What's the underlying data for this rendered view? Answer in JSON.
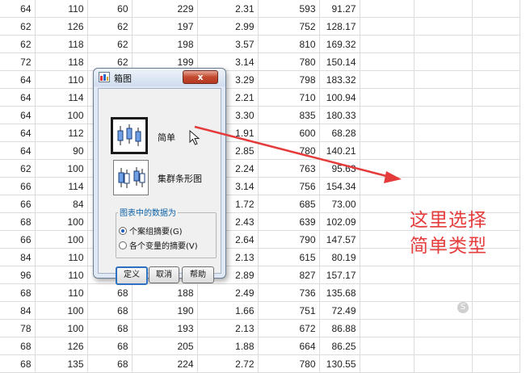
{
  "spreadsheet": {
    "rows": [
      [
        "64",
        "110",
        "60",
        "229",
        "2.31",
        "593",
        "91.27",
        "",
        ""
      ],
      [
        "62",
        "126",
        "62",
        "197",
        "2.99",
        "752",
        "128.17",
        "",
        ""
      ],
      [
        "62",
        "118",
        "62",
        "198",
        "3.57",
        "810",
        "169.32",
        "",
        ""
      ],
      [
        "72",
        "118",
        "62",
        "199",
        "3.14",
        "780",
        "150.14",
        "",
        ""
      ],
      [
        "64",
        "110",
        "62",
        "",
        "3.29",
        "798",
        "183.32",
        "",
        ""
      ],
      [
        "64",
        "114",
        "",
        "",
        "2.21",
        "710",
        "100.94",
        "",
        ""
      ],
      [
        "64",
        "100",
        "",
        "",
        "3.30",
        "835",
        "180.33",
        "",
        ""
      ],
      [
        "64",
        "112",
        "",
        "",
        "1.91",
        "600",
        "68.28",
        "",
        ""
      ],
      [
        "64",
        "90",
        "",
        "",
        "2.85",
        "780",
        "140.21",
        "",
        ""
      ],
      [
        "62",
        "100",
        "",
        "",
        "2.24",
        "763",
        "95.63",
        "",
        ""
      ],
      [
        "66",
        "114",
        "",
        "",
        "3.14",
        "756",
        "154.34",
        "",
        ""
      ],
      [
        "66",
        "84",
        "",
        "",
        "1.72",
        "685",
        "73.00",
        "",
        ""
      ],
      [
        "68",
        "100",
        "",
        "",
        "2.43",
        "639",
        "102.09",
        "",
        ""
      ],
      [
        "66",
        "100",
        "",
        "",
        "2.64",
        "790",
        "147.57",
        "",
        ""
      ],
      [
        "84",
        "110",
        "",
        "",
        "2.13",
        "615",
        "80.19",
        "",
        ""
      ],
      [
        "96",
        "110",
        "",
        "",
        "2.89",
        "827",
        "157.17",
        "",
        ""
      ],
      [
        "68",
        "110",
        "68",
        "188",
        "2.49",
        "736",
        "135.68",
        "",
        ""
      ],
      [
        "84",
        "100",
        "68",
        "190",
        "1.66",
        "751",
        "72.49",
        "",
        ""
      ],
      [
        "78",
        "100",
        "68",
        "193",
        "2.13",
        "672",
        "86.88",
        "",
        ""
      ],
      [
        "68",
        "126",
        "68",
        "205",
        "1.88",
        "664",
        "86.25",
        "",
        ""
      ],
      [
        "68",
        "135",
        "68",
        "224",
        "2.72",
        "780",
        "130.55",
        "",
        ""
      ]
    ]
  },
  "dialog": {
    "title": "箱图",
    "close_glyph": "x",
    "options": [
      {
        "label": "简单",
        "selected": true
      },
      {
        "label": "集群条形图",
        "selected": false
      }
    ],
    "group_title": "图表中的数据为",
    "radios": [
      {
        "label": "个案组摘要(G)",
        "selected": true
      },
      {
        "label": "各个变量的摘要(V)",
        "selected": false
      }
    ],
    "buttons": {
      "define": "定义",
      "cancel": "取消",
      "help": "帮助"
    }
  },
  "annotation": {
    "line1": "这里选择",
    "line2": "简单类型",
    "color": "#e53c3c"
  },
  "watermark": "S"
}
